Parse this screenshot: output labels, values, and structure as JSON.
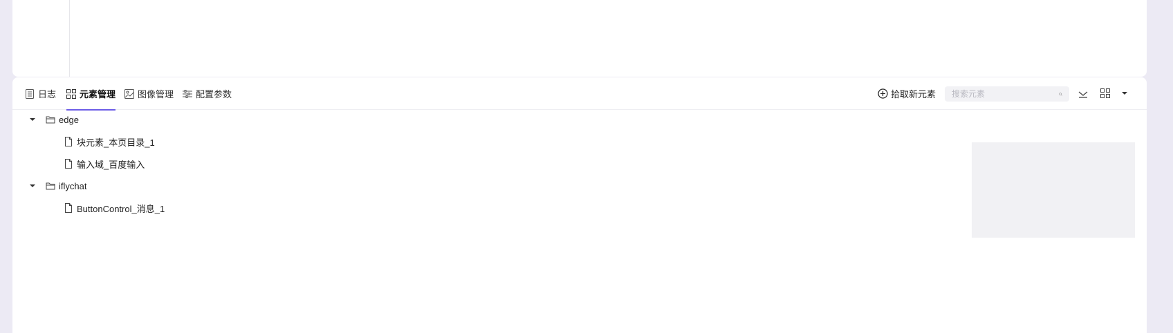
{
  "tabs": [
    {
      "label": "日志",
      "icon": "log-icon",
      "active": false
    },
    {
      "label": "元素管理",
      "icon": "grid-icon",
      "active": true
    },
    {
      "label": "图像管理",
      "icon": "image-icon",
      "active": false
    },
    {
      "label": "配置参数",
      "icon": "sliders-icon",
      "active": false
    }
  ],
  "toolbar": {
    "pick_label": "拾取新元素",
    "search_placeholder": "搜索元素"
  },
  "tree": [
    {
      "type": "folder",
      "label": "edge",
      "expanded": true
    },
    {
      "type": "file",
      "label": "块元素_本页目录_1"
    },
    {
      "type": "file",
      "label": "输入域_百度输入"
    },
    {
      "type": "folder",
      "label": "iflychat",
      "expanded": true
    },
    {
      "type": "file",
      "label": "ButtonControl_消息_1"
    }
  ],
  "colors": {
    "accent": "#6c5ce7",
    "background": "#eceaf4",
    "panel": "#ffffff"
  }
}
